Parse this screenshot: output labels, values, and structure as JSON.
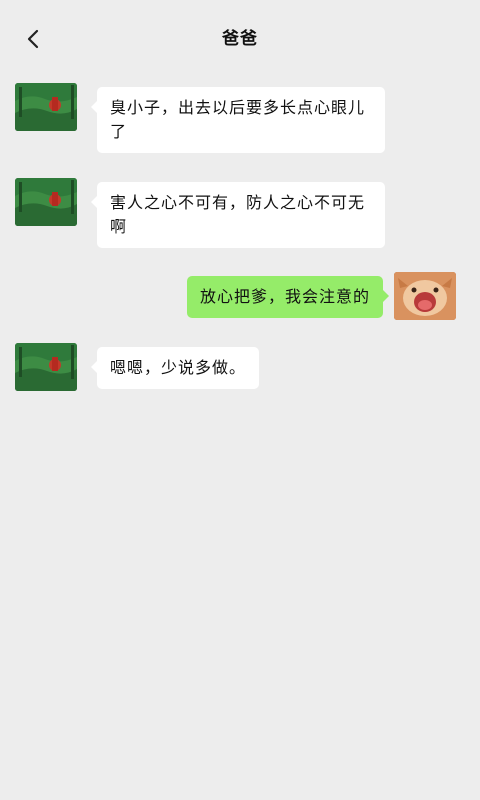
{
  "header": {
    "title": "爸爸",
    "back_icon": "chevron-left-icon"
  },
  "colors": {
    "background": "#ededed",
    "bubble_incoming": "#ffffff",
    "bubble_outgoing": "#95ec69"
  },
  "messages": [
    {
      "sender": "dad",
      "text": "臭小子，出去以后要多长点心眼儿了"
    },
    {
      "sender": "dad",
      "text": "害人之心不可有，防人之心不可无啊"
    },
    {
      "sender": "me",
      "text": "放心把爹，我会注意的"
    },
    {
      "sender": "dad",
      "text": "嗯嗯，少说多做。"
    }
  ]
}
